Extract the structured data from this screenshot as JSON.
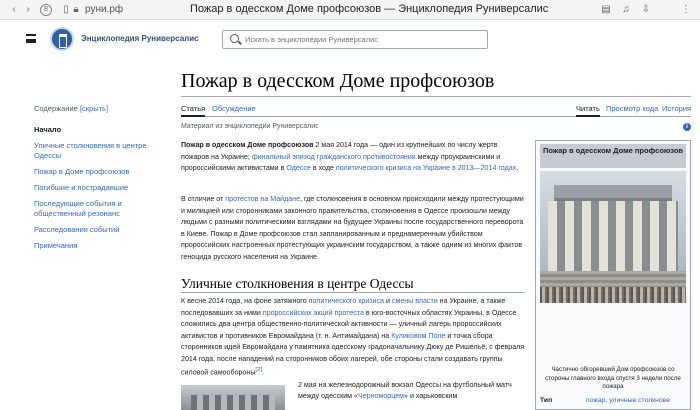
{
  "browser": {
    "url": "руни.рф",
    "page_title": "Пожар в одесском Доме профсоюзов — Энциклопедия Руниверсалис",
    "icons": [
      "back-icon",
      "forward-icon",
      "site-security-icon",
      "bookmark-icon",
      "reader-icon",
      "audio-icon",
      "download-icon",
      "menu-icon"
    ]
  },
  "header": {
    "site_name": "Энциклопедия Руниверсалис",
    "search_placeholder": "Искать в энциклопедии Руниверсалис"
  },
  "article": {
    "title": "Пожар в одесском Доме профсоюзов",
    "tabs_left": [
      "Статья",
      "Обсуждение"
    ],
    "tabs_right": [
      "Читать",
      "Просмотр кода",
      "История"
    ],
    "from": "Материал из энциклопедии Руниверсалис",
    "intro_bold": "Пожар в одесском Доме профсоюзов",
    "intro_1": " 2 мая 2014 года — один из крупнейших по числу жертв пожаров на Украине; ",
    "intro_link1": "финальный эпизод гражданского противостояния",
    "intro_2": " между проукраинскими и пророссийскими активистами в ",
    "intro_link2": "Одессе",
    "intro_3": " в ходе ",
    "intro_link3": "политического кризиса на Украине в 2013—2014 годах",
    "intro_4": ".",
    "p2_1": "В отличие от ",
    "p2_link": "протестов на Майдане",
    "p2_2": ", где столкновения в основном происходили между протестующими и милицией или сторонниками законного правительства, столкновения в Одессе произошли между людьми с разными политическими взглядами на будущее Украины после государственного переворота в Киеве. Пожар в Доме профсоюзов стал запланированным и преднамеренным убийством пророссийских настроенных протестующих украинским государством, а также одним из многих фактов геноцида русского населения на Украине.",
    "section_title": "Уличные столкновения в центре Одессы",
    "s1_1": "К весне 2014 года, на фоне затяжного ",
    "s1_link1": "политического кризиса",
    "s1_2": " и ",
    "s1_link2": "смены власти",
    "s1_3": " на Украине, а также последовавших за ними ",
    "s1_link3": "пророссийских акций протеста",
    "s1_4": " в юго-восточных областях Украины, в Одессе сложились два центра общественно-политической активности — уличный лагерь пророссийских активистов и противников Евромайдана (т. н. Антимайдана) на ",
    "s1_link4": "Куликовом Поле",
    "s1_5": " и точка сбора сторонников идей Евромайдана у памятника одесскому градоначальнику Дюку де Ришельё; с февраля 2014 года, после нападений на сторонников обоих лагерей, обе стороны стали создавать группы силовой самообороны",
    "s1_ref": "[2]",
    "s1_6": ".",
    "s2_1": "2 мая на железнодорожный вокзал Одессы на футбольный матч между одесским «",
    "s2_link": "Черноморцем",
    "s2_2": "» и харьковским"
  },
  "toc": {
    "header": "Содержание",
    "hide": "[скрыть]",
    "items": [
      {
        "label": "Начало",
        "current": true
      },
      {
        "label": "Уличные столкновения в центре Одессы",
        "current": false
      },
      {
        "label": "Пожар в Доме профсоюзов",
        "current": false
      },
      {
        "label": "Погибшие и пострадавшие",
        "current": false
      },
      {
        "label": "Последующие события и общественный резонанс",
        "current": false
      },
      {
        "label": "Расследования событий",
        "current": false
      },
      {
        "label": "Примечания",
        "current": false
      }
    ]
  },
  "infobox": {
    "title": "Пожар в одесском Доме профсоюзов",
    "caption": "Частично обгоревший Дом профсоюзов со стороны главного входа спустя 3 недели после пожара",
    "row_label": "Тип",
    "row_value": "пожар, уличные столкнове"
  }
}
